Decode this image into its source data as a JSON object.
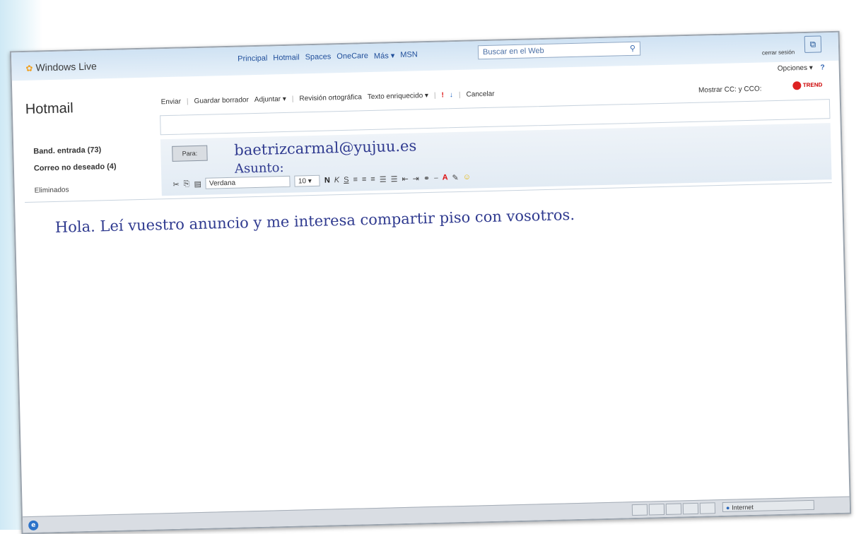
{
  "brand": "Windows Live",
  "nav": [
    "Principal",
    "Hotmail",
    "Spaces",
    "OneCare",
    "Más ▾",
    "MSN"
  ],
  "search": {
    "placeholder": "Buscar en el Web"
  },
  "account": {
    "logout": "cerrar sesión",
    "options": "Opciones ▾"
  },
  "app_title": "Hotmail",
  "toolbar": {
    "send": "Enviar",
    "save_draft": "Guardar borrador",
    "attach": "Adjuntar ▾",
    "spellcheck": "Revisión ortográfica",
    "rich_text": "Texto enriquecido ▾",
    "cancel": "Cancelar"
  },
  "show_cc": "Mostrar CC: y CCO:",
  "trend_logo": "TREND",
  "sidebar": {
    "inbox": "Band. entrada (73)",
    "junk": "Correo no deseado (4)",
    "deleted": "Eliminados"
  },
  "compose": {
    "to_button": "Para:",
    "to_value": "baetrizcarmal@yujuu.es",
    "subject_label": "Asunto:",
    "font": "Verdana",
    "size": "10 ▾",
    "body": "Hola. Leí vuestro anuncio y me interesa compartir piso con vosotros."
  },
  "status": {
    "zone": "Internet"
  },
  "colors": {
    "accent": "#1f4e9a",
    "message_text": "#2f3a8f"
  }
}
